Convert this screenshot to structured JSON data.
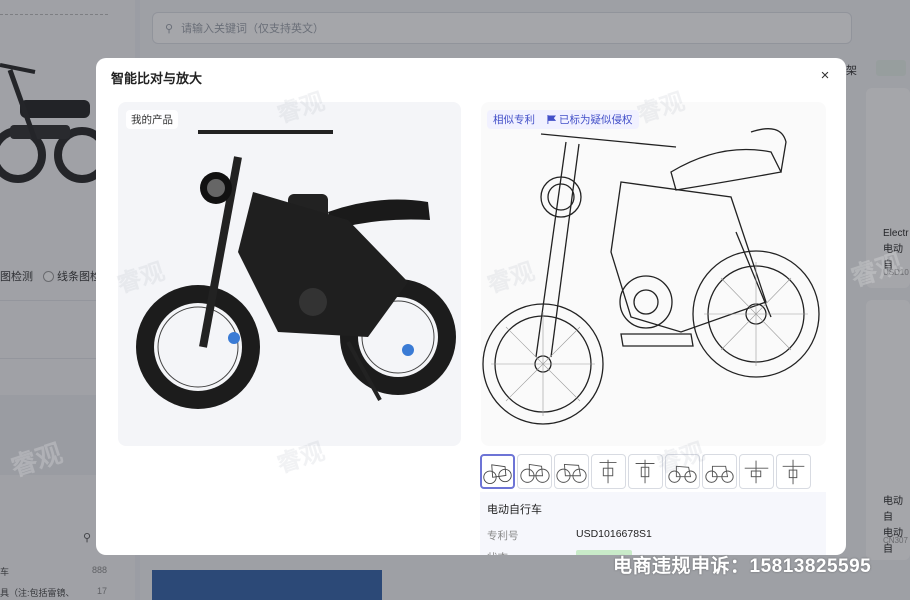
{
  "background": {
    "search_placeholder": "请输入关键词（仅支持英文）",
    "radio_options": [
      "图检测",
      "线条图检"
    ],
    "categories": [
      {
        "label": "车",
        "count": "888"
      },
      {
        "label": "具（注:包括雷镜、",
        "count": "17"
      }
    ],
    "card_texts": [
      {
        "line1": "Electr",
        "line2": "电动自",
        "code": "USD10"
      },
      {
        "line1": "电动自",
        "line2": "电动自",
        "code": "CN307"
      }
    ],
    "tab_label": "架"
  },
  "watermark_text": "睿观",
  "dialog": {
    "title": "智能比对与放大",
    "close_label": "×",
    "left_tag": "我的产品",
    "right_tag_similar": "相似专利",
    "right_tag_flag": "已标为疑似侵权",
    "thumbnail_count": 9,
    "product_name": "电动自行车",
    "patent_label": "专利号",
    "patent_number": "USD1016678S1",
    "status_label": "状态"
  },
  "footer_watermark": "电商违规申诉：15813825595",
  "colors": {
    "accent": "#4350c8",
    "active_thumb": "#6d74d6"
  }
}
